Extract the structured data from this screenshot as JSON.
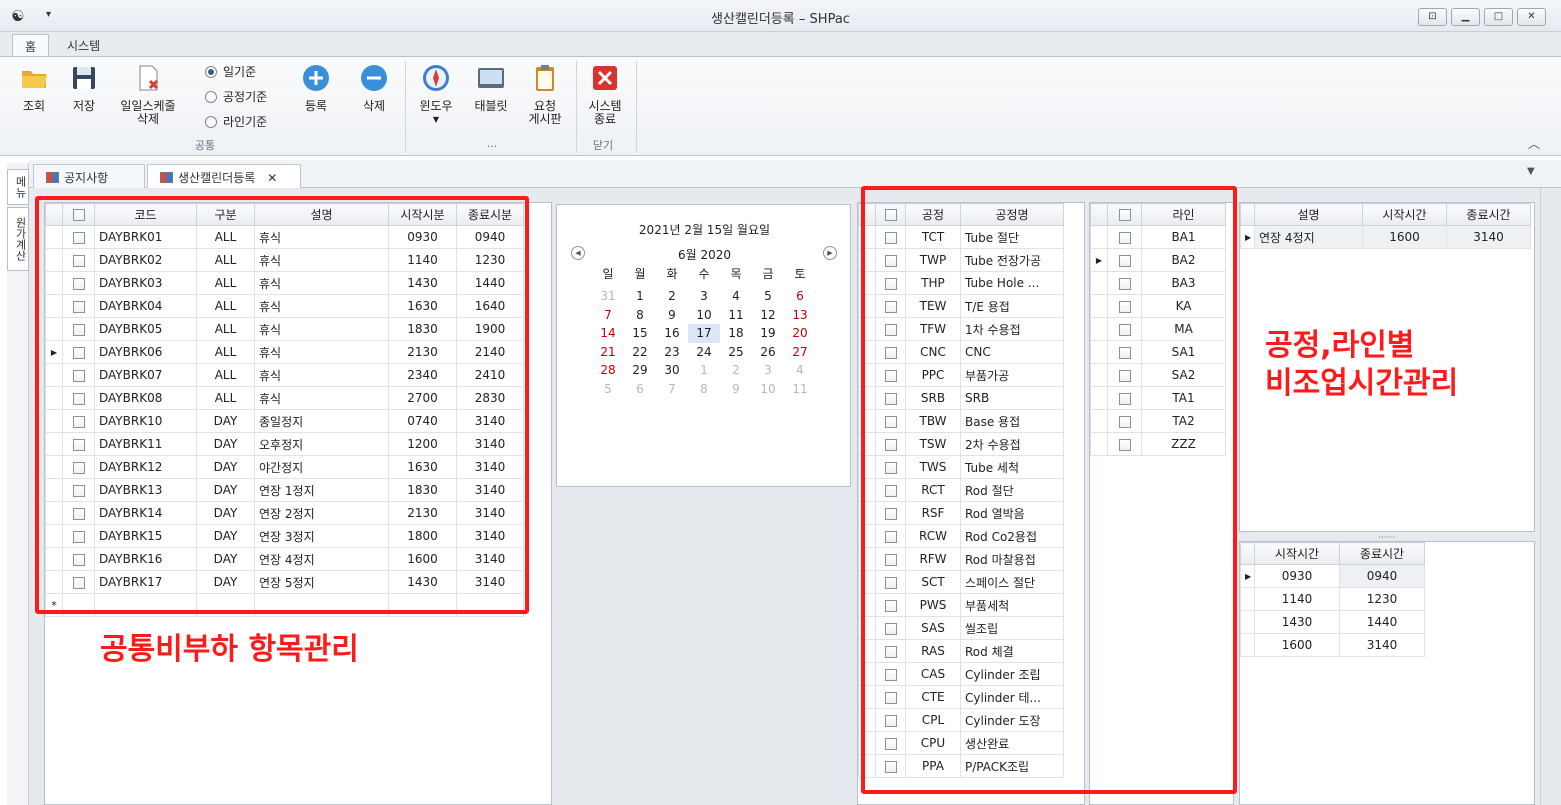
{
  "window": {
    "title": "생산캘린더등록",
    "app": "SHPac"
  },
  "ribbon_tabs": [
    "홈",
    "시스템"
  ],
  "ribbon": {
    "buttons": {
      "query": "조회",
      "save": "저장",
      "daily_delete_1": "일일스케줄",
      "daily_delete_2": "삭제",
      "register": "등록",
      "delete": "삭제",
      "window": "윈도우",
      "tablet": "태블릿",
      "request_1": "요청",
      "request_2": "게시판",
      "sys_exit_1": "시스템",
      "sys_exit_2": "종료"
    },
    "radios": [
      {
        "label": "일기준",
        "checked": true
      },
      {
        "label": "공정기준",
        "checked": false
      },
      {
        "label": "라인기준",
        "checked": false
      }
    ],
    "groups": {
      "common": "공통",
      "more": "...",
      "close": "닫기"
    }
  },
  "side_tabs": [
    "메뉴",
    "원가계산"
  ],
  "doc_tabs": [
    {
      "label": "공지사항",
      "active": false
    },
    {
      "label": "생산캘린더등록",
      "active": true
    }
  ],
  "left_grid": {
    "columns": [
      "코드",
      "구분",
      "설명",
      "시작시분",
      "종료시분"
    ],
    "rows": [
      [
        "DAYBRK01",
        "ALL",
        "휴식",
        "0930",
        "0940"
      ],
      [
        "DAYBRK02",
        "ALL",
        "휴식",
        "1140",
        "1230"
      ],
      [
        "DAYBRK03",
        "ALL",
        "휴식",
        "1430",
        "1440"
      ],
      [
        "DAYBRK04",
        "ALL",
        "휴식",
        "1630",
        "1640"
      ],
      [
        "DAYBRK05",
        "ALL",
        "휴식",
        "1830",
        "1900"
      ],
      [
        "DAYBRK06",
        "ALL",
        "휴식",
        "2130",
        "2140"
      ],
      [
        "DAYBRK07",
        "ALL",
        "휴식",
        "2340",
        "2410"
      ],
      [
        "DAYBRK08",
        "ALL",
        "휴식",
        "2700",
        "2830"
      ],
      [
        "DAYBRK10",
        "DAY",
        "종일정지",
        "0740",
        "3140"
      ],
      [
        "DAYBRK11",
        "DAY",
        "오후정지",
        "1200",
        "3140"
      ],
      [
        "DAYBRK12",
        "DAY",
        "야간정지",
        "1630",
        "3140"
      ],
      [
        "DAYBRK13",
        "DAY",
        "연장 1정지",
        "1830",
        "3140"
      ],
      [
        "DAYBRK14",
        "DAY",
        "연장 2정지",
        "2130",
        "3140"
      ],
      [
        "DAYBRK15",
        "DAY",
        "연장 3정지",
        "1800",
        "3140"
      ],
      [
        "DAYBRK16",
        "DAY",
        "연장 4정지",
        "1600",
        "3140"
      ],
      [
        "DAYBRK17",
        "DAY",
        "연장 5정지",
        "1430",
        "3140"
      ]
    ],
    "current_row": 5,
    "new_row_marker": "*"
  },
  "calendar": {
    "date_text": "2021년 2월 15일 월요일",
    "month_text": "6월 2020",
    "weekdays": [
      "일",
      "월",
      "화",
      "수",
      "목",
      "금",
      "토"
    ],
    "weeks": [
      [
        "31",
        "1",
        "2",
        "3",
        "4",
        "5",
        "6"
      ],
      [
        "7",
        "8",
        "9",
        "10",
        "11",
        "12",
        "13"
      ],
      [
        "14",
        "15",
        "16",
        "17",
        "18",
        "19",
        "20"
      ],
      [
        "21",
        "22",
        "23",
        "24",
        "25",
        "26",
        "27"
      ],
      [
        "28",
        "29",
        "30",
        "1",
        "2",
        "3",
        "4"
      ],
      [
        "5",
        "6",
        "7",
        "8",
        "9",
        "10",
        "11"
      ]
    ],
    "selected_day": "17",
    "weekend_color": "#c00000",
    "other_month_color": "#b4b8be"
  },
  "process_grid": {
    "columns": [
      "공정",
      "공정명"
    ],
    "rows": [
      [
        "TCT",
        "Tube 절단"
      ],
      [
        "TWP",
        "Tube 전장가공"
      ],
      [
        "THP",
        "Tube Hole ..."
      ],
      [
        "TEW",
        "T/E 용접"
      ],
      [
        "TFW",
        "1차 수용접"
      ],
      [
        "CNC",
        "CNC"
      ],
      [
        "PPC",
        "부품가공"
      ],
      [
        "SRB",
        "SRB"
      ],
      [
        "TBW",
        "Base 용접"
      ],
      [
        "TSW",
        "2차 수용접"
      ],
      [
        "TWS",
        "Tube 세척"
      ],
      [
        "RCT",
        "Rod 절단"
      ],
      [
        "RSF",
        "Rod 열박음"
      ],
      [
        "RCW",
        "Rod Co2용접"
      ],
      [
        "RFW",
        "Rod 마찰용접"
      ],
      [
        "SCT",
        "스페이스 절단"
      ],
      [
        "PWS",
        "부품세척"
      ],
      [
        "SAS",
        "씰조립"
      ],
      [
        "RAS",
        "Rod 체결"
      ],
      [
        "CAS",
        "Cylinder 조립"
      ],
      [
        "CTE",
        "Cylinder 테..."
      ],
      [
        "CPL",
        "Cylinder 도장"
      ],
      [
        "CPU",
        "생산완료"
      ],
      [
        "PPA",
        "P/PACK조립"
      ]
    ]
  },
  "line_grid": {
    "columns": [
      "라인"
    ],
    "rows": [
      "BA1",
      "BA2",
      "BA3",
      "KA",
      "MA",
      "SA1",
      "SA2",
      "TA1",
      "TA2",
      "ZZZ"
    ],
    "current_row": 1
  },
  "desc_grid": {
    "columns": [
      "설명",
      "시작시간",
      "종료시간"
    ],
    "rows": [
      [
        "연장 4정지",
        "1600",
        "3140"
      ]
    ]
  },
  "time_grid": {
    "columns": [
      "시작시간",
      "종료시간"
    ],
    "rows": [
      [
        "0930",
        "0940"
      ],
      [
        "1140",
        "1230"
      ],
      [
        "1430",
        "1440"
      ],
      [
        "1600",
        "3140"
      ]
    ]
  },
  "annotations": {
    "common": "공통비부하 항목관리",
    "process_line_1": "공정,라인별",
    "process_line_2": "비조업시간관리",
    "color": "#ff1a1a"
  }
}
